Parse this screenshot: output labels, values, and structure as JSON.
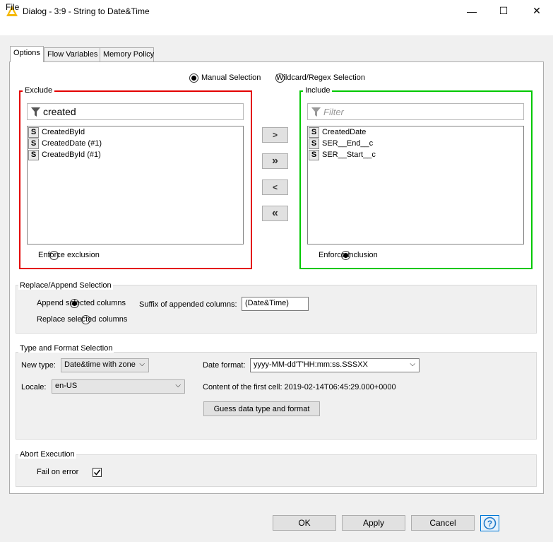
{
  "window": {
    "title": "Dialog - 3:9 - String to Date&Time",
    "minimize_glyph": "—",
    "maximize_glyph": "☐",
    "close_glyph": "✕"
  },
  "menu": {
    "file": "File"
  },
  "tabs": [
    {
      "label": "Options",
      "active": true
    },
    {
      "label": "Flow Variables",
      "active": false
    },
    {
      "label": "Memory Policy",
      "active": false
    }
  ],
  "selection_mode": {
    "manual": "Manual Selection",
    "wildcard": "Wildcard/Regex Selection",
    "selected": "manual"
  },
  "exclude": {
    "title": "Exclude",
    "filter_value": "created",
    "items": [
      "CreatedById",
      "CreatedDate (#1)",
      "CreatedById (#1)"
    ],
    "type_badge": "S",
    "enforce_label": "Enforce exclusion"
  },
  "include": {
    "title": "Include",
    "filter_placeholder": "Filter",
    "items": [
      "CreatedDate",
      "SER__End__c",
      "SER__Start__c"
    ],
    "type_badge": "S",
    "enforce_label": "Enforce inclusion"
  },
  "move_buttons": {
    "add": ">",
    "add_all": "»",
    "remove": "<",
    "remove_all": "«"
  },
  "replace_append": {
    "title": "Replace/Append Selection",
    "append_label": "Append selected columns",
    "replace_label": "Replace selected columns",
    "suffix_label": "Suffix of appended columns:",
    "suffix_value": "(Date&Time)"
  },
  "type_format": {
    "title": "Type and Format Selection",
    "new_type_label": "New type:",
    "new_type_value": "Date&time with zone",
    "locale_label": "Locale:",
    "locale_value": "en-US",
    "date_format_label": "Date format:",
    "date_format_value": "yyyy-MM-dd'T'HH:mm:ss.SSSXX",
    "first_cell_text": "Content of the first cell: 2019-02-14T06:45:29.000+0000",
    "guess_button": "Guess data type and format"
  },
  "abort": {
    "title": "Abort Execution",
    "fail_on_error_label": "Fail on error",
    "fail_on_error_checked": true
  },
  "footer": {
    "ok": "OK",
    "apply": "Apply",
    "cancel": "Cancel",
    "help": "?"
  },
  "colors": {
    "exclude_border": "#e30000",
    "include_border": "#00c800",
    "app_icon": "#f5b800"
  },
  "icons": [
    "knime-triangle-icon",
    "filter-funnel-icon",
    "help-icon",
    "checkmark-icon"
  ]
}
